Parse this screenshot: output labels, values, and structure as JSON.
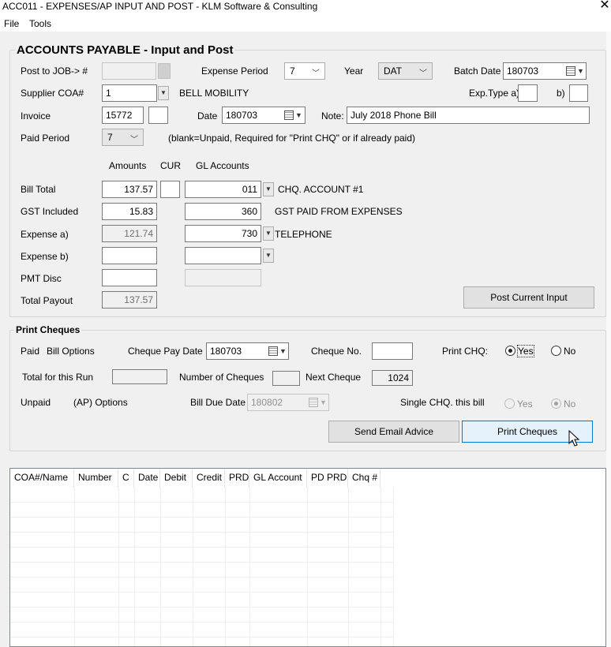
{
  "window": {
    "title": "ACC011 - EXPENSES/AP INPUT AND POST - KLM Software & Consulting",
    "close_glyph": "✕"
  },
  "menu": {
    "file": "File",
    "tools": "Tools"
  },
  "ap": {
    "title": "ACCOUNTS PAYABLE - Input and Post",
    "post_to_job_label": "Post to JOB-> #",
    "expense_period_label": "Expense Period",
    "expense_period_value": "7",
    "year_label": "Year",
    "year_value": "DAT",
    "batch_date_label": "Batch Date",
    "batch_date_value": "180703",
    "supplier_label": "Supplier COA#",
    "supplier_value": "1",
    "supplier_name": "BELL MOBILITY",
    "exp_type_a_label": "Exp.Type a)",
    "exp_type_b_label": "b)",
    "invoice_label": "Invoice",
    "invoice_value": "15772",
    "date_label": "Date",
    "date_value": "180703",
    "note_label": "Note:",
    "note_value": "July 2018 Phone Bill",
    "paid_period_label": "Paid Period",
    "paid_period_value": "7",
    "paid_period_hint": "(blank=Unpaid, Required for \"Print CHQ\" or if already paid)",
    "col_amounts": "Amounts",
    "col_cur": "CUR",
    "col_gl": "GL Accounts",
    "rows": {
      "bill_total": {
        "label": "Bill Total",
        "amount": "137.57",
        "gl": "011",
        "gl_name": "CHQ. ACCOUNT #1"
      },
      "gst_included": {
        "label": "GST Included",
        "amount": "15.83",
        "gl": "360",
        "gl_name": "GST PAID FROM EXPENSES"
      },
      "expense_a": {
        "label": "Expense a)",
        "amount": "121.74",
        "gl": "730",
        "gl_name": "TELEPHONE"
      },
      "expense_b": {
        "label": "Expense b)",
        "amount": "",
        "gl": ""
      },
      "pmt_disc": {
        "label": "PMT Disc",
        "amount": ""
      },
      "total_payout": {
        "label": "Total Payout",
        "amount": "137.57"
      }
    },
    "post_button": "Post Current Input"
  },
  "cheques": {
    "title": "Print Cheques",
    "paid_label": "Paid",
    "bill_options_label": "Bill Options",
    "cheque_pay_date_label": "Cheque Pay Date",
    "cheque_pay_date_value": "180703",
    "cheque_no_label": "Cheque No.",
    "cheque_no_value": "",
    "print_chq_label": "Print CHQ:",
    "yes_label": "Yes",
    "no_label": "No",
    "total_run_label": "Total for this Run",
    "total_run_value": "",
    "num_cheques_label": "Number of Cheques",
    "num_cheques_value": "",
    "next_cheque_label": "Next Cheque",
    "next_cheque_value": "1024",
    "unpaid_label": "Unpaid",
    "ap_options_label": "(AP) Options",
    "bill_due_date_label": "Bill Due Date",
    "bill_due_date_value": "180802",
    "single_chq_label": "Single CHQ. this bill",
    "single_yes_label": "Yes",
    "single_no_label": "No",
    "email_button": "Send Email Advice",
    "print_button": "Print Cheques"
  },
  "grid": {
    "columns": [
      "COA#/Name",
      "Number",
      "C",
      "Date",
      "Debit",
      "Credit",
      "PRD",
      "GL Account",
      "PD PRD",
      "Chq #"
    ]
  }
}
